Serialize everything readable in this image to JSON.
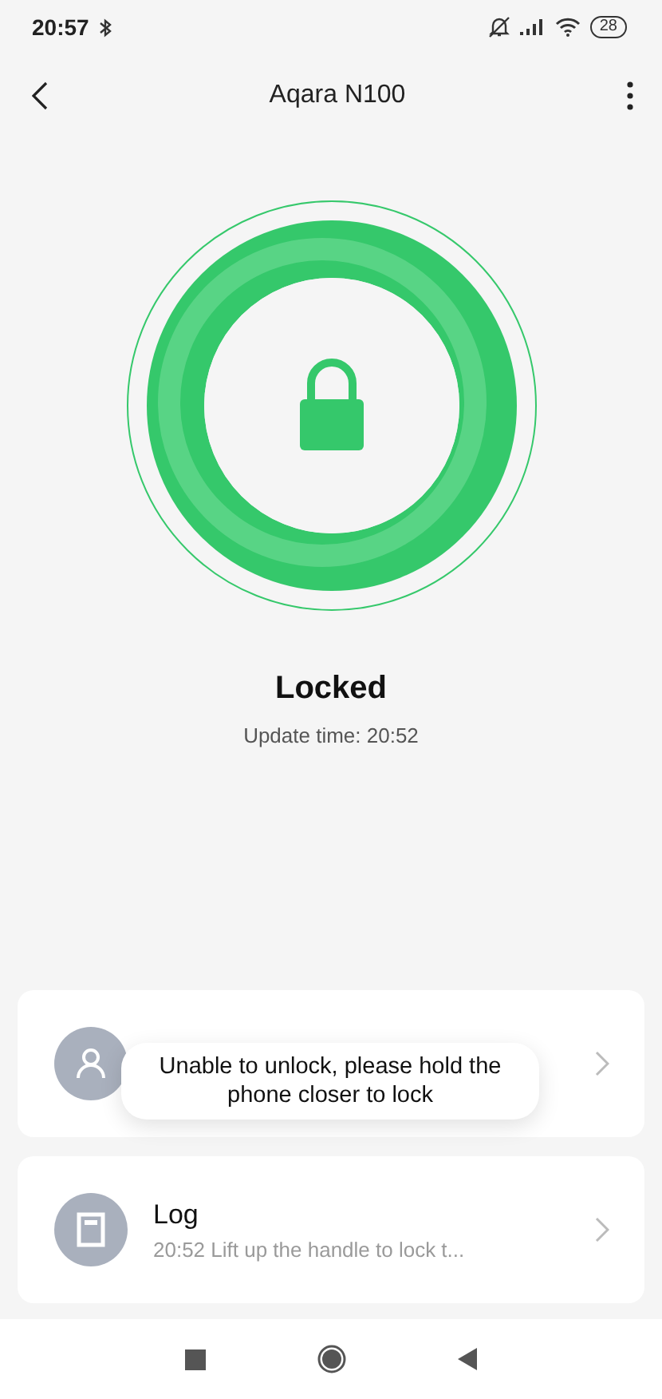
{
  "status_bar": {
    "time": "20:57",
    "battery": "28"
  },
  "header": {
    "title": "Aqara N100"
  },
  "lock": {
    "status": "Locked",
    "update_time": "Update time: 20:52",
    "locked": true
  },
  "cards": [
    {
      "kind": "users"
    },
    {
      "kind": "log",
      "title": "Log",
      "subtitle": "20:52 Lift up the handle to lock t..."
    }
  ],
  "toast": {
    "message": "Unable to unlock, please hold the phone closer to lock"
  }
}
